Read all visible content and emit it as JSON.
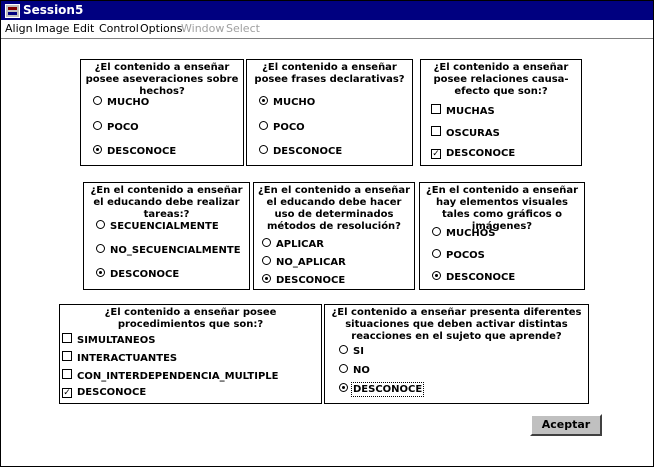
{
  "window": {
    "title": "Session5"
  },
  "menu": [
    {
      "label": "Align",
      "enabled": true
    },
    {
      "label": "Image",
      "enabled": true
    },
    {
      "label": "Edit",
      "enabled": true
    },
    {
      "label": "Control",
      "enabled": true
    },
    {
      "label": "Options",
      "enabled": true
    },
    {
      "label": "Window",
      "enabled": false
    },
    {
      "label": "Select",
      "enabled": false
    }
  ],
  "panels": [
    {
      "question": "¿El contenido a enseñar posee aseveraciones sobre hechos?",
      "type": "radio",
      "options": [
        {
          "label": "MUCHO",
          "checked": false
        },
        {
          "label": "POCO",
          "checked": false
        },
        {
          "label": "DESCONOCE",
          "checked": true
        }
      ]
    },
    {
      "question": "¿El contenido a enseñar posee frases declarativas?",
      "type": "radio",
      "options": [
        {
          "label": "MUCHO",
          "checked": true
        },
        {
          "label": "POCO",
          "checked": false
        },
        {
          "label": "DESCONOCE",
          "checked": false
        }
      ]
    },
    {
      "question": "¿El contenido a enseñar posee relaciones causa-efecto que son:?",
      "type": "checkbox",
      "options": [
        {
          "label": "MUCHAS",
          "checked": false
        },
        {
          "label": "OSCURAS",
          "checked": false
        },
        {
          "label": "DESCONOCE",
          "checked": true
        }
      ]
    },
    {
      "question": "¿En el contenido a enseñar el educando debe realizar tareas:?",
      "type": "radio",
      "options": [
        {
          "label": "SECUENCIALMENTE",
          "checked": false
        },
        {
          "label": "NO_SECUENCIALMENTE",
          "checked": false
        },
        {
          "label": "DESCONOCE",
          "checked": true
        }
      ]
    },
    {
      "question": "¿En el contenido a enseñar el educando debe hacer uso de determinados métodos de resolución?",
      "type": "radio",
      "options": [
        {
          "label": "APLICAR",
          "checked": false
        },
        {
          "label": "NO_APLICAR",
          "checked": false
        },
        {
          "label": "DESCONOCE",
          "checked": true
        }
      ]
    },
    {
      "question": "¿En el contenido a enseñar hay elementos visuales tales como gráficos o imágenes?",
      "type": "radio",
      "options": [
        {
          "label": "MUCHOS",
          "checked": false
        },
        {
          "label": "POCOS",
          "checked": false
        },
        {
          "label": "DESCONOCE",
          "checked": true
        }
      ]
    },
    {
      "question": "¿El contenido a enseñar posee procedimientos que son:?",
      "type": "checkbox",
      "options": [
        {
          "label": "SIMULTANEOS",
          "checked": false
        },
        {
          "label": "INTERACTUANTES",
          "checked": false
        },
        {
          "label": "CON_INTERDEPENDENCIA_MULTIPLE",
          "checked": false
        },
        {
          "label": "DESCONOCE",
          "checked": true
        }
      ]
    },
    {
      "question": "¿El contenido a enseñar presenta diferentes situaciones que deben activar distintas reacciones en el sujeto que aprende?",
      "type": "radio",
      "options": [
        {
          "label": "SI",
          "checked": false
        },
        {
          "label": "NO",
          "checked": false
        },
        {
          "label": "DESCONOCE",
          "checked": true,
          "focused": true
        }
      ]
    }
  ],
  "accept_button": {
    "label": "Aceptar"
  }
}
